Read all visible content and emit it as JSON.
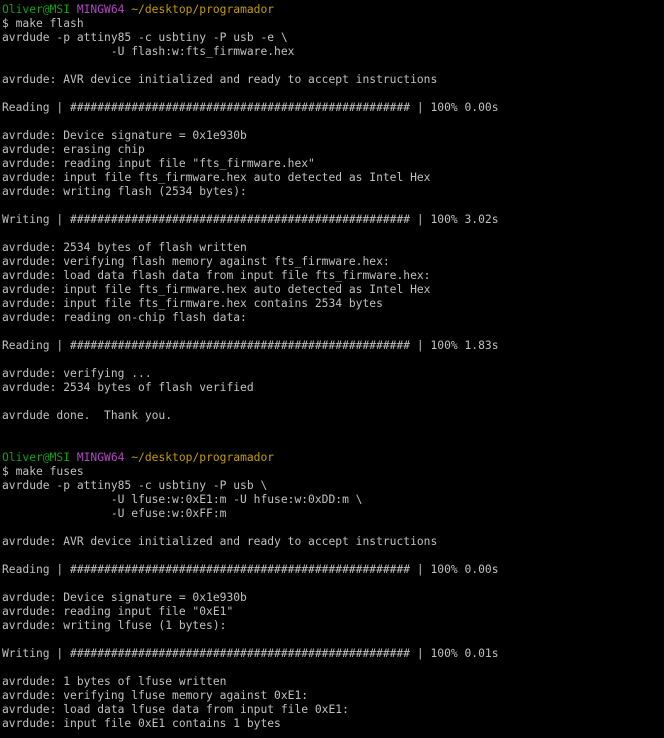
{
  "colors": {
    "background": "#000000",
    "text": "#c0c0c0",
    "prompt_user": "#13a10e",
    "prompt_env": "#b148c6",
    "prompt_path": "#c19c00"
  },
  "lines": [
    {
      "kind": "prompt",
      "user": "Oliver@MSI",
      "env": "MINGW64",
      "path": "~/desktop/programador"
    },
    {
      "kind": "text",
      "text": "$ make flash"
    },
    {
      "kind": "text",
      "text": "avrdude -p attiny85 -c usbtiny -P usb -e \\"
    },
    {
      "kind": "text",
      "text": "                -U flash:w:fts_firmware.hex"
    },
    {
      "kind": "blank"
    },
    {
      "kind": "text",
      "text": "avrdude: AVR device initialized and ready to accept instructions"
    },
    {
      "kind": "blank"
    },
    {
      "kind": "text",
      "text": "Reading | ################################################## | 100% 0.00s"
    },
    {
      "kind": "blank"
    },
    {
      "kind": "text",
      "text": "avrdude: Device signature = 0x1e930b"
    },
    {
      "kind": "text",
      "text": "avrdude: erasing chip"
    },
    {
      "kind": "text",
      "text": "avrdude: reading input file \"fts_firmware.hex\""
    },
    {
      "kind": "text",
      "text": "avrdude: input file fts_firmware.hex auto detected as Intel Hex"
    },
    {
      "kind": "text",
      "text": "avrdude: writing flash (2534 bytes):"
    },
    {
      "kind": "blank"
    },
    {
      "kind": "text",
      "text": "Writing | ################################################## | 100% 3.02s"
    },
    {
      "kind": "blank"
    },
    {
      "kind": "text",
      "text": "avrdude: 2534 bytes of flash written"
    },
    {
      "kind": "text",
      "text": "avrdude: verifying flash memory against fts_firmware.hex:"
    },
    {
      "kind": "text",
      "text": "avrdude: load data flash data from input file fts_firmware.hex:"
    },
    {
      "kind": "text",
      "text": "avrdude: input file fts_firmware.hex auto detected as Intel Hex"
    },
    {
      "kind": "text",
      "text": "avrdude: input file fts_firmware.hex contains 2534 bytes"
    },
    {
      "kind": "text",
      "text": "avrdude: reading on-chip flash data:"
    },
    {
      "kind": "blank"
    },
    {
      "kind": "text",
      "text": "Reading | ################################################## | 100% 1.83s"
    },
    {
      "kind": "blank"
    },
    {
      "kind": "text",
      "text": "avrdude: verifying ..."
    },
    {
      "kind": "text",
      "text": "avrdude: 2534 bytes of flash verified"
    },
    {
      "kind": "blank"
    },
    {
      "kind": "text",
      "text": "avrdude done.  Thank you."
    },
    {
      "kind": "blank"
    },
    {
      "kind": "blank"
    },
    {
      "kind": "prompt",
      "user": "Oliver@MSI",
      "env": "MINGW64",
      "path": "~/desktop/programador"
    },
    {
      "kind": "text",
      "text": "$ make fuses"
    },
    {
      "kind": "text",
      "text": "avrdude -p attiny85 -c usbtiny -P usb \\"
    },
    {
      "kind": "text",
      "text": "                -U lfuse:w:0xE1:m -U hfuse:w:0xDD:m \\"
    },
    {
      "kind": "text",
      "text": "                -U efuse:w:0xFF:m"
    },
    {
      "kind": "blank"
    },
    {
      "kind": "text",
      "text": "avrdude: AVR device initialized and ready to accept instructions"
    },
    {
      "kind": "blank"
    },
    {
      "kind": "text",
      "text": "Reading | ################################################## | 100% 0.00s"
    },
    {
      "kind": "blank"
    },
    {
      "kind": "text",
      "text": "avrdude: Device signature = 0x1e930b"
    },
    {
      "kind": "text",
      "text": "avrdude: reading input file \"0xE1\""
    },
    {
      "kind": "text",
      "text": "avrdude: writing lfuse (1 bytes):"
    },
    {
      "kind": "blank"
    },
    {
      "kind": "text",
      "text": "Writing | ################################################## | 100% 0.01s"
    },
    {
      "kind": "blank"
    },
    {
      "kind": "text",
      "text": "avrdude: 1 bytes of lfuse written"
    },
    {
      "kind": "text",
      "text": "avrdude: verifying lfuse memory against 0xE1:"
    },
    {
      "kind": "text",
      "text": "avrdude: load data lfuse data from input file 0xE1:"
    },
    {
      "kind": "text",
      "text": "avrdude: input file 0xE1 contains 1 bytes"
    }
  ]
}
